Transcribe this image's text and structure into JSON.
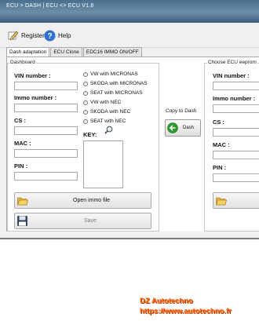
{
  "window": {
    "title": "ECU > DASH | ECU <> ECU  V1.8"
  },
  "menu": {
    "register": "Register",
    "help": "Help"
  },
  "tabs": [
    "Dash adaptation",
    "ECU Clone",
    "EDC16 IMMO ON/OFF"
  ],
  "dashboard": {
    "group_title": "Dashboard",
    "vin_label": "VIN number :",
    "immo_label": "Immo number :",
    "cs_label": "CS :",
    "mac_label": "MAC :",
    "pin_label": "PIN :"
  },
  "radios": [
    "VW with MICRONAS",
    "SKODA with MICRONAS",
    "SEAT with MICRONAS",
    "VW with NEC",
    "SKODA with NEC",
    "SEAT with NEC"
  ],
  "key_label": "KEY:",
  "copy_label": "Copy to Dash",
  "dash_button": "Dash",
  "open_immo_button": "Open immo file",
  "save_button": "Save",
  "right": {
    "group_title": "Choose ECU eeprom",
    "vin_label": "VIN number :",
    "immo_label": "Immo number :",
    "cs_label": "CS :",
    "mac_label": "MAC :",
    "pin_label": "PIN :"
  },
  "watermark": {
    "line1": "DZ Autotechno",
    "line2": "https://www.autotechno.fr"
  },
  "colors": {
    "titlebar": "#4b6f8f",
    "watermark": "#ff6a1a",
    "dash_icon": "#2e9b2e"
  }
}
